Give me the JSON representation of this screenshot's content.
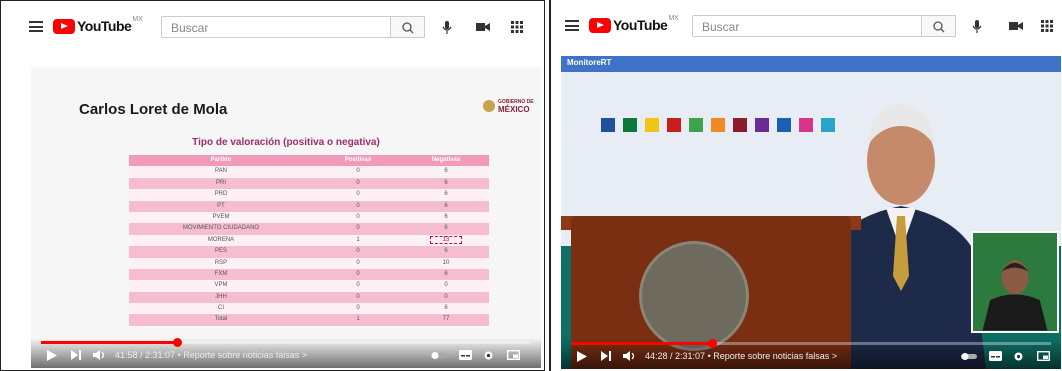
{
  "left_window": {
    "topbar": {
      "logo_text": "YouTube",
      "country_code": "MX",
      "search_placeholder": "Buscar"
    },
    "slide": {
      "name": "Carlos Loret de Mola",
      "logo_small": "GOBIERNO DE",
      "logo_big": "MÉXICO",
      "table_title": "Tipo de valoración (positiva o negativa)",
      "headers": [
        "Partido",
        "Positivas",
        "Negativas"
      ],
      "rows": [
        {
          "partido": "PAN",
          "pos": "0",
          "neg": "6"
        },
        {
          "partido": "PRI",
          "pos": "0",
          "neg": "6"
        },
        {
          "partido": "PRD",
          "pos": "0",
          "neg": "6"
        },
        {
          "partido": "PT",
          "pos": "0",
          "neg": "6"
        },
        {
          "partido": "PVEM",
          "pos": "0",
          "neg": "6"
        },
        {
          "partido": "MOVIMIENTO CIUDADANO",
          "pos": "0",
          "neg": "6"
        },
        {
          "partido": "MORENA",
          "pos": "1",
          "neg": "13"
        },
        {
          "partido": "PES",
          "pos": "0",
          "neg": "6"
        },
        {
          "partido": "RSP",
          "pos": "0",
          "neg": "10"
        },
        {
          "partido": "FXM",
          "pos": "0",
          "neg": "6"
        },
        {
          "partido": "VPM",
          "pos": "0",
          "neg": "0"
        },
        {
          "partido": "JHH",
          "pos": "0",
          "neg": "0"
        },
        {
          "partido": "CI",
          "pos": "0",
          "neg": "6"
        },
        {
          "partido": "Total",
          "pos": "1",
          "neg": "77"
        }
      ]
    },
    "player": {
      "time": "41:58 / 2:31:07",
      "chapter": "• Reporte sobre noticias falsas",
      "chapter_chevron": ">",
      "progress_fraction": 0.278
    }
  },
  "right_window": {
    "topbar": {
      "logo_text": "YouTube",
      "country_code": "MX",
      "search_placeholder": "Buscar"
    },
    "scene": {
      "monitor_logo": "MonitoreRT"
    },
    "player": {
      "time": "44:28 / 2:31:07",
      "chapter": "• Reporte sobre noticias falsas",
      "chapter_chevron": ">",
      "progress_fraction": 0.294
    }
  },
  "colors": {
    "youtube_red": "#ff0000",
    "table_header_pink": "#f29ab9",
    "table_row_pink": "#f6bdd1",
    "title_magenta": "#9b2d6b",
    "highlight_red": "#c8102e"
  },
  "icons": [
    "menu-icon",
    "youtube-logo-icon",
    "search-icon",
    "mic-icon",
    "create-video-icon",
    "apps-grid-icon",
    "play-icon",
    "next-icon",
    "volume-icon",
    "autoplay-toggle-icon",
    "subtitles-icon",
    "settings-gear-icon",
    "miniplayer-icon"
  ]
}
